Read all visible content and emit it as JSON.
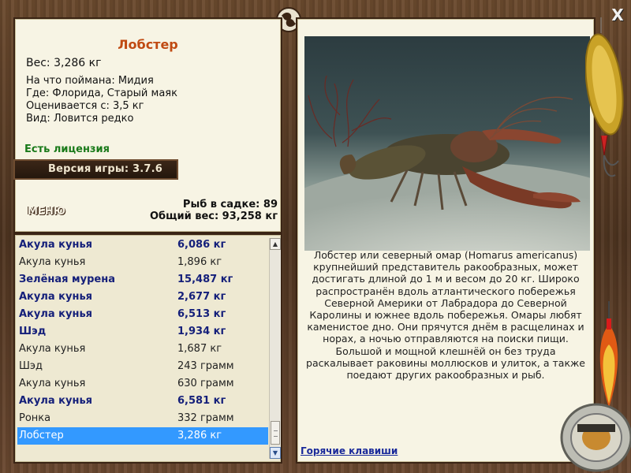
{
  "fish": {
    "title": "Лобстер",
    "weight": "Вес: 3,286 кг",
    "caught_on": "На что поймана: Мидия",
    "location": "Где: Флорида, Старый маяк",
    "valued_from": "Оценивается с: 3,5 кг",
    "rarity": "Вид: Ловится редко",
    "license": "Есть лицензия",
    "description": "Лобстер или северный омар (Homarus americanus) крупнейший представитель ракообразных, может достигать длиной до 1 м и весом до 20 кг. Широко распространён вдоль атлантического побережья Северной Америки от Лабрадора до Северной Каролины и южнее вдоль побережья. Омары любят каменистое дно. Они прячутся днём в расщелинах и норах, а ночью отправляются на поиски пищи. Большой и мощной клешнёй он без труда раскалывает раковины моллюсков и улиток, а также поедают других ракообразных и рыб."
  },
  "game": {
    "version": "Версия игры: 3.7.6",
    "menu_label": "МЕНЮ",
    "fish_in_keepnet": "Рыб в садке: 89",
    "total_weight": "Общий вес: 93,258 кг",
    "hotkeys_label": "Горячие клавиши",
    "close_label": "X"
  },
  "catch_list": [
    {
      "name": "Акула кунья",
      "weight": "6,086 кг",
      "rare": true
    },
    {
      "name": "Акула кунья",
      "weight": "1,896 кг",
      "rare": false
    },
    {
      "name": "Зелёная мурена",
      "weight": "15,487 кг",
      "rare": true
    },
    {
      "name": "Акула кунья",
      "weight": "2,677 кг",
      "rare": true
    },
    {
      "name": "Акула кунья",
      "weight": "6,513 кг",
      "rare": true
    },
    {
      "name": "Шэд",
      "weight": "1,934 кг",
      "rare": true
    },
    {
      "name": "Акула кунья",
      "weight": "1,687 кг",
      "rare": false
    },
    {
      "name": "Шэд",
      "weight": "243 грамм",
      "rare": false
    },
    {
      "name": "Акула кунья",
      "weight": "630 грамм",
      "rare": false
    },
    {
      "name": "Акула кунья",
      "weight": "6,581 кг",
      "rare": true
    },
    {
      "name": "Ронка",
      "weight": "332 грамм",
      "rare": false
    },
    {
      "name": "Лобстер",
      "weight": "3,286 кг",
      "rare": false,
      "selected": true
    }
  ],
  "icons": {
    "emblem": "pisces-emblem-icon",
    "close": "close-icon",
    "scroll_up": "arrow-up-icon",
    "scroll_down": "arrow-down-icon"
  },
  "colors": {
    "title": "#c04a12",
    "license": "#1a7a1a",
    "rare_text": "#15207a",
    "selection": "#3399ff"
  }
}
